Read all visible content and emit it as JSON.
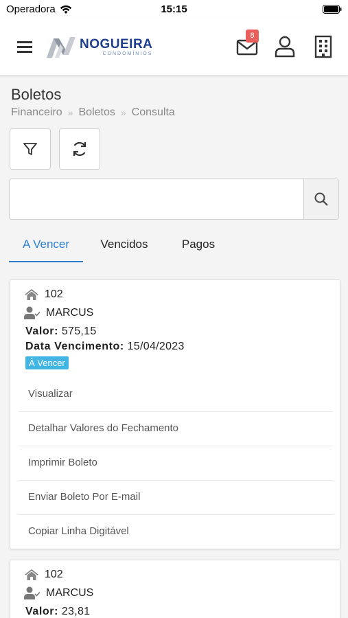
{
  "status_bar": {
    "carrier": "Operadora",
    "time": "15:15"
  },
  "header": {
    "logo": {
      "brand": "NOGUEIRA",
      "sub": "CONDOMÍNIOS"
    },
    "mail_badge": "8"
  },
  "page": {
    "title": "Boletos",
    "breadcrumb": [
      "Financeiro",
      "Boletos",
      "Consulta"
    ]
  },
  "search": {
    "placeholder": "",
    "value": ""
  },
  "tabs": [
    {
      "label": "A Vencer",
      "active": true
    },
    {
      "label": "Vencidos",
      "active": false
    },
    {
      "label": "Pagos",
      "active": false
    }
  ],
  "cards": [
    {
      "unit": "102",
      "owner": "MARCUS",
      "valor_label": "Valor:",
      "valor": "575,15",
      "venc_label": "Data Vencimento:",
      "venc": "15/04/2023",
      "status": "À Vencer",
      "actions": [
        "Visualizar",
        "Detalhar Valores do Fechamento",
        "Imprimir Boleto",
        "Enviar Boleto Por E-mail",
        "Copiar Linha Digitável"
      ]
    },
    {
      "unit": "102",
      "owner": "MARCUS",
      "valor_label": "Valor:",
      "valor": "23,81"
    }
  ],
  "colors": {
    "accent": "#2b7fd0",
    "status_badge": "#41b5e4",
    "mail_badge": "#e85f5c",
    "brand": "#1e3f8c"
  },
  "icons": [
    "wifi-icon",
    "battery-icon",
    "menu-icon",
    "mail-icon",
    "user-icon",
    "building-icon",
    "filter-icon",
    "refresh-icon",
    "search-icon",
    "home-icon",
    "user-check-icon"
  ]
}
